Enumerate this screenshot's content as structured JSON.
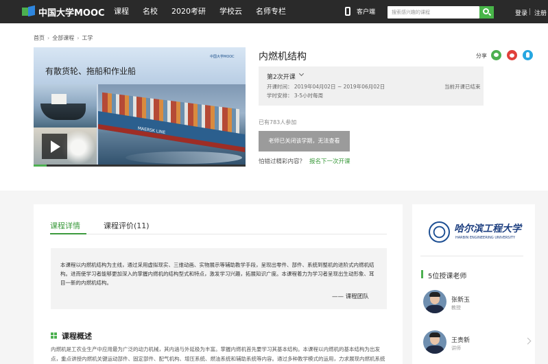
{
  "nav": {
    "logo_text": "中国大学MOOC",
    "menu": [
      "课程",
      "名校",
      "2020考研",
      "学校云",
      "名师专栏"
    ],
    "client_label": "客户端",
    "search_placeholder": "搜索感兴趣的课程",
    "login": "登录",
    "register": "注册"
  },
  "breadcrumb": [
    "首页",
    "全部课程",
    "工学"
  ],
  "cover": {
    "headline": "有散货轮、拖船和作业船",
    "brand": "中国大学MOOC",
    "ship_text": "MAERSK LINE",
    "progress": 0.06
  },
  "course": {
    "title": "内燃机结构",
    "share_label": "分享",
    "term": "第2次开课",
    "time_line": "开课时间： 2019年04月02日 ~ 2019年06月02日",
    "schedule_line": "学时安排： 3-5小时每周",
    "term_status": "当前开课已结束",
    "enrolled": "已有783人参加",
    "closed_button": "老师已关闭该学期，无法查看",
    "missed_text": "怕错过精彩内容？",
    "signup_link": "报名下一次开课"
  },
  "tabs": {
    "detail": "课程详情",
    "review": "课程评价(11)"
  },
  "intro": {
    "text": "本课程以内燃机结构为主线，通过采用虚拟现实、三维动画、实物展示等辅助教学手段，呈现出零件、部件、系统到整机的进阶式内燃机结构。进而使学习者能够更加深入的掌握内燃机的结构型式和特点，激发学习兴趣，拓展知识广度。本课程着力为学习者呈现出生动形象、耳目一新的内燃机结构。",
    "signature": "—— 课程团队"
  },
  "overview": {
    "title": "课程概述",
    "text": "内燃机是工农业生产中应用最为广泛的动力机械，其内涵与外延极为丰富。掌握内燃机首先要学习其基本结构。本课程以内燃机的基本结构为出发点，重点讲授内燃机关键运动部件、固定部件、配气机构、增压系统、燃油系统和辅助系统等内容。通过多种教学模式的运用，力求展现内燃机系统的复杂结构"
  },
  "sidebar": {
    "university_cn": "哈尔滨工程大学",
    "university_en": "HARBIN ENGINEERING UNIVERSITY",
    "teachers_title": "5位授课老师",
    "teachers": [
      {
        "name": "张新玉",
        "role": "教授"
      },
      {
        "name": "王贵新",
        "role": "讲师"
      }
    ]
  },
  "colors": {
    "accent_green": "#3b9a3c",
    "nav_bg": "#2a2a2a",
    "disabled_button": "#9b9b9b"
  }
}
